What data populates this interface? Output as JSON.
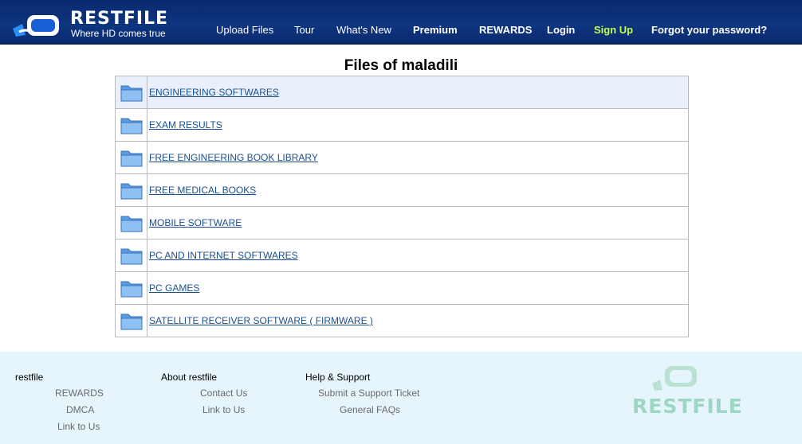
{
  "header": {
    "brand": "RESTFILE",
    "tagline": "Where HD comes true",
    "nav": [
      {
        "label": "Upload Files"
      },
      {
        "label": "Tour"
      },
      {
        "label": "What's New"
      },
      {
        "label": "Premium"
      },
      {
        "label": "REWARDS"
      },
      {
        "label": "Login"
      },
      {
        "label": "Sign Up"
      },
      {
        "label": "Forgot your password?"
      }
    ],
    "colors": {
      "bar": "#0e357f",
      "signup": "#c3ff4a"
    }
  },
  "page": {
    "title": "Files of maladili"
  },
  "folders": [
    {
      "name": "ENGINEERING SOFTWARES",
      "icon": "folder-icon"
    },
    {
      "name": "EXAM RESULTS",
      "icon": "folder-icon"
    },
    {
      "name": "FREE ENGINEERING BOOK LIBRARY",
      "icon": "folder-icon"
    },
    {
      "name": "FREE MEDICAL BOOKS",
      "icon": "folder-icon"
    },
    {
      "name": "MOBILE SOFTWARE",
      "icon": "folder-icon"
    },
    {
      "name": "PC AND INTERNET SOFTWARES",
      "icon": "folder-icon"
    },
    {
      "name": "PC GAMES",
      "icon": "folder-icon"
    },
    {
      "name": "SATELLITE RECEIVER SOFTWARE ( FIRMWARE )",
      "icon": "folder-icon"
    }
  ],
  "footer": {
    "col1": {
      "title": "restfile",
      "links": [
        "REWARDS",
        "DMCA",
        "Link to Us"
      ]
    },
    "col2": {
      "title": "About restfile",
      "links": [
        "Contact Us",
        "Link to Us"
      ]
    },
    "col3": {
      "title": "Help & Support",
      "links": [
        "Submit a Support Ticket",
        "General FAQs"
      ]
    },
    "brand": "RESTFILE"
  }
}
